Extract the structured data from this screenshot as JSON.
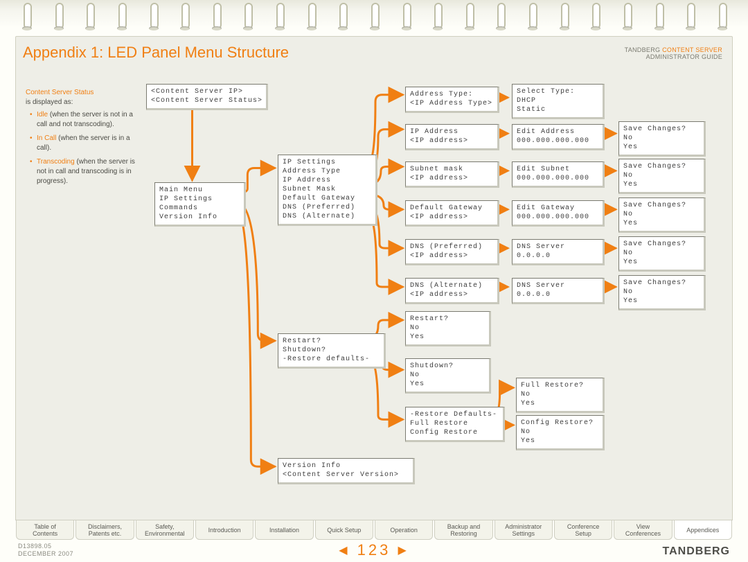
{
  "header": {
    "title": "Appendix 1: LED Panel Menu Structure",
    "doc_line1_a": "TANDBERG ",
    "doc_line1_b": "CONTENT SERVER",
    "doc_line2": "ADMINISTRATOR GUIDE"
  },
  "legend": {
    "heading": "Content Server Status",
    "after_heading": "is displayed as:",
    "items": [
      {
        "key": "Idle",
        "rest": " (when the server is not in a call and not transcoding)."
      },
      {
        "key": "In Call",
        "rest": " (when the server is in a call)."
      },
      {
        "key": "Transcoding",
        "rest": " (when the server is not in call and transcoding is in progress)."
      }
    ]
  },
  "boxes": {
    "root": "<Content Server IP>\n<Content Server Status>",
    "mainmenu": "Main Menu\nIP Settings\nCommands\nVersion Info",
    "ipsettings": "IP Settings\nAddress Type\nIP Address\nSubnet Mask\nDefault Gateway\nDNS (Preferred)\nDNS (Alternate)",
    "addrtype": "Address Type:\n<IP Address Type>",
    "seltype": "Select Type:\nDHCP\nStatic",
    "ipaddr": "IP Address\n<IP address>",
    "editaddr": "Edit Address\n000.000.000.000",
    "subnet": "Subnet mask\n<IP address>",
    "editsubnet": "Edit Subnet\n000.000.000.000",
    "gateway": "Default Gateway\n<IP address>",
    "editgateway": "Edit Gateway\n000.000.000.000",
    "dnspref": "DNS (Preferred)\n<IP address>",
    "dnsserver1": "DNS Server\n0.0.0.0",
    "dnsalt": "DNS (Alternate)\n<IP address>",
    "dnsserver2": "DNS Server\n0.0.0.0",
    "save": "Save Changes?\nNo\nYes",
    "cmds": "Restart?\nShutdown?\n-Restore defaults-",
    "restartq": "Restart?\nNo\nYes",
    "shutdownq": "Shutdown?\nNo\nYes",
    "restoredef": "-Restore Defaults-\nFull Restore\nConfig Restore",
    "fullrestore": "Full Restore?\nNo\nYes",
    "configrestore": "Config Restore?\nNo\nYes",
    "version": "Version Info\n<Content Server Version>"
  },
  "tabs": [
    "Table of\nContents",
    "Disclaimers,\nPatents etc.",
    "Safety,\nEnvironmental",
    "Introduction",
    "Installation",
    "Quick Setup",
    "Operation",
    "Backup and\nRestoring",
    "Administrator\nSettings",
    "Conference\nSetup",
    "View\nConferences",
    "Appendices"
  ],
  "active_tab_index": 11,
  "footer": {
    "docnum": "D13898.05",
    "date": "DECEMBER 2007",
    "page": "123",
    "brand": "TANDBERG"
  }
}
